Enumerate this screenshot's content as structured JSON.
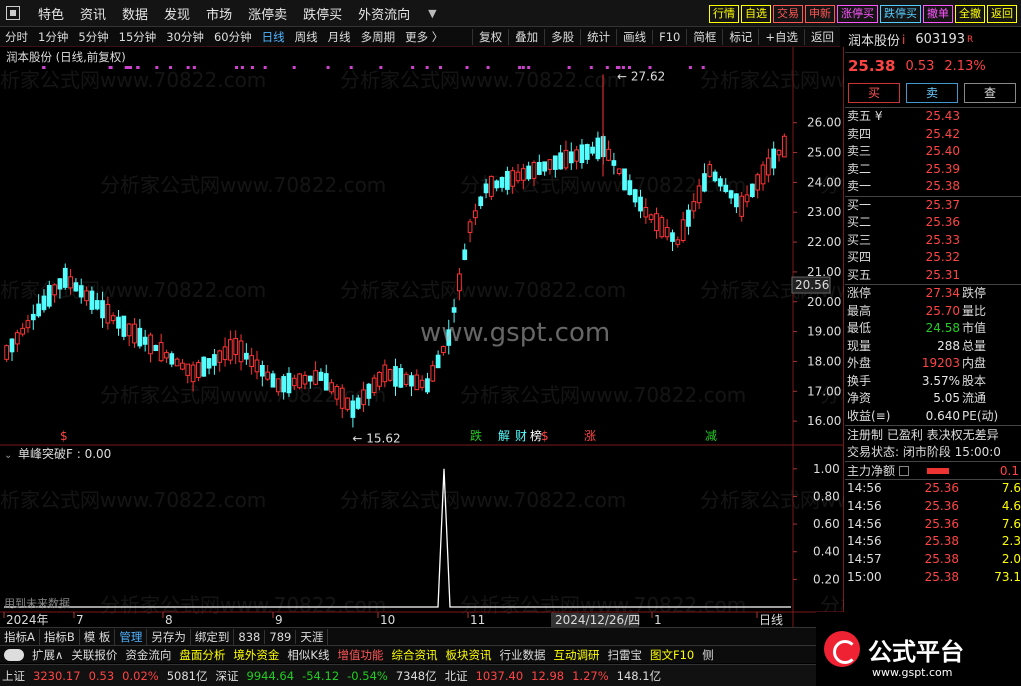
{
  "app": {
    "top_menu": [
      "特色",
      "资讯",
      "数据",
      "发现",
      "市场",
      "涨停卖",
      "跌停买",
      "外资流向"
    ],
    "right_buttons": [
      {
        "label": "行情",
        "color": "#ff0"
      },
      {
        "label": "自选",
        "color": "#ff0"
      },
      {
        "label": "交易",
        "color": "#f55"
      },
      {
        "label": "申新",
        "color": "#f55"
      },
      {
        "label": "涨停买",
        "color": "#f5f"
      },
      {
        "label": "跌停买",
        "color": "#5cf"
      },
      {
        "label": "撤单",
        "color": "#f5f"
      },
      {
        "label": "全撤",
        "color": "#ff0"
      },
      {
        "label": "返回",
        "color": "#ff0"
      }
    ]
  },
  "toolbar": {
    "periods": [
      "分时",
      "1分钟",
      "5分钟",
      "15分钟",
      "30分钟",
      "60分钟",
      "日线",
      "周线",
      "月线",
      "多周期",
      "更多 〉"
    ],
    "active": "日线",
    "tools": [
      "复权",
      "叠加",
      "多股",
      "统计",
      "画线",
      "F10",
      "简框",
      "标记",
      "+自选",
      "返回"
    ]
  },
  "chart_title": "润本股份 (日线,前复权)",
  "indicator_title": "单峰突破F : 0.00",
  "future_note": "用到未来数据",
  "watermark": "分析家公式网www.70822.com",
  "site": "www.gspt.com",
  "chart_data": [
    {
      "type": "candlestick",
      "title": "润本股份 (日线,前复权)",
      "ylim": [
        15.2,
        27.8
      ],
      "yticks": [
        16,
        17,
        18,
        19,
        20,
        21,
        22,
        23,
        24,
        25,
        26
      ],
      "current_price_tag": "20.56",
      "annotations": [
        {
          "label": "27.62"
        },
        {
          "label": "15.62"
        }
      ],
      "x_labels": [
        "2024年",
        "7",
        "8",
        "9",
        "10",
        "11",
        "2024/12/26/四",
        "1",
        "日线"
      ],
      "event_markers": [
        {
          "label": "$",
          "color": "#f44"
        },
        {
          "label": "跌",
          "color": "#2c2"
        },
        {
          "label": "解",
          "color": "#5ff"
        },
        {
          "label": "财",
          "color": "#5ff"
        },
        {
          "label": "榜",
          "color": "#fff"
        },
        {
          "label": "$",
          "color": "#f44"
        },
        {
          "label": "涨",
          "color": "#f44"
        },
        {
          "label": "减",
          "color": "#2c2"
        }
      ]
    },
    {
      "type": "line",
      "title": "单峰突破F : 0.00",
      "ylim": [
        0,
        1.1
      ],
      "yticks": [
        "1.00",
        "0.80",
        "0.60",
        "0.40",
        "0.20"
      ],
      "peak_value": 1.0
    }
  ],
  "sidebar": {
    "name": "润本股份",
    "badge": "i",
    "code": "603193",
    "code_flag": "R",
    "price": "25.38",
    "change": "0.53",
    "pct": "2.13%",
    "buttons": [
      "买",
      "卖",
      "查"
    ],
    "asks": [
      {
        "label": "卖五 ¥",
        "price": "25.43"
      },
      {
        "label": "卖四",
        "price": "25.42"
      },
      {
        "label": "卖三",
        "price": "25.40"
      },
      {
        "label": "卖二",
        "price": "25.39"
      },
      {
        "label": "卖一",
        "price": "25.38"
      }
    ],
    "bids": [
      {
        "label": "买一",
        "price": "25.37"
      },
      {
        "label": "买二",
        "price": "25.36"
      },
      {
        "label": "买三",
        "price": "25.33"
      },
      {
        "label": "买四",
        "price": "25.32"
      },
      {
        "label": "买五",
        "price": "25.31"
      }
    ],
    "stats": [
      {
        "k": "涨停",
        "v": "27.34",
        "vc": "#f44",
        "k2": "跌停"
      },
      {
        "k": "最高",
        "v": "25.70",
        "vc": "#f44",
        "k2": "量比"
      },
      {
        "k": "最低",
        "v": "24.58",
        "vc": "#2c2",
        "k2": "市值"
      },
      {
        "k": "现量",
        "v": "288",
        "vc": "#e6e6e6",
        "k2": "总量"
      },
      {
        "k": "外盘",
        "v": "19203",
        "vc": "#f44",
        "k2": "内盘"
      },
      {
        "k": "换手",
        "v": "3.57%",
        "vc": "#e6e6e6",
        "k2": "股本"
      },
      {
        "k": "净资",
        "v": "5.05",
        "vc": "#e6e6e6",
        "k2": "流通"
      },
      {
        "k": "收益(≡)",
        "v": "0.640",
        "vc": "#e6e6e6",
        "k2": "PE(动)"
      }
    ],
    "reg": "注册制 已盈利 表决权无差异",
    "trade_state": "交易状态: 闭市阶段 15:00:0",
    "mainflow": "主力净额",
    "mainflow_val": "0.1",
    "trades": [
      {
        "t": "14:56",
        "p": "25.36",
        "q": "7.6"
      },
      {
        "t": "14:56",
        "p": "25.36",
        "q": "4.6"
      },
      {
        "t": "14:56",
        "p": "25.36",
        "q": "7.6"
      },
      {
        "t": "14:56",
        "p": "25.38",
        "q": "2.3"
      },
      {
        "t": "14:57",
        "p": "25.38",
        "q": "2.0"
      },
      {
        "t": "15:00",
        "p": "25.38",
        "q": "73.1"
      }
    ]
  },
  "tabs": [
    "指标A",
    "指标B",
    "模 板",
    "管理",
    "另存为",
    "绑定到",
    "838",
    "789",
    "天涯"
  ],
  "active_tab": "管理",
  "funcbar": [
    "扩展∧",
    "关联报价",
    "资金流向",
    "盘面分析",
    "境外资金",
    "相似K线",
    "增值功能",
    "综合资讯",
    "板块资讯",
    "行业数据",
    "互动调研",
    "扫雷宝",
    "图文F10",
    "侧"
  ],
  "status": [
    {
      "t": "上证",
      "c": "#ddd"
    },
    {
      "t": "3230.17",
      "c": "#f44"
    },
    {
      "t": "0.53",
      "c": "#f44"
    },
    {
      "t": "0.02%",
      "c": "#f44"
    },
    {
      "t": "5081亿",
      "c": "#ddd"
    },
    {
      "t": "深证",
      "c": "#ddd"
    },
    {
      "t": "9944.64",
      "c": "#2c2"
    },
    {
      "t": "-54.12",
      "c": "#2c2"
    },
    {
      "t": "-0.54%",
      "c": "#2c2"
    },
    {
      "t": "7348亿",
      "c": "#ddd"
    },
    {
      "t": "北证",
      "c": "#ddd"
    },
    {
      "t": "1037.40",
      "c": "#f44"
    },
    {
      "t": "12.98",
      "c": "#f44"
    },
    {
      "t": "1.27%",
      "c": "#f44"
    },
    {
      "t": "148.1亿",
      "c": "#ddd"
    }
  ],
  "brand": {
    "title": "公式平台",
    "url": "www.gspt.com"
  }
}
